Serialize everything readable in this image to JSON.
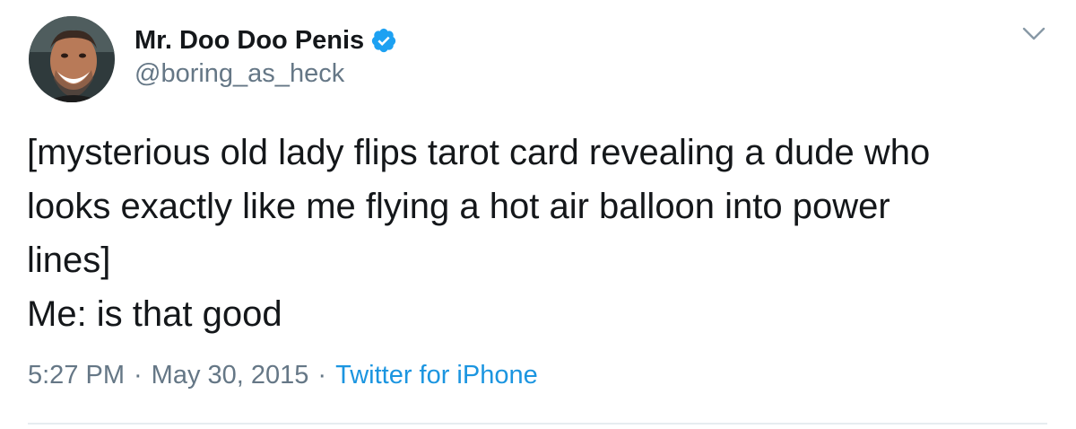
{
  "author": {
    "display_name": "Mr. Doo Doo Penis",
    "handle": "@boring_as_heck",
    "verified": true,
    "avatar_icon": "user-avatar"
  },
  "tweet": {
    "lines": [
      "[mysterious old lady flips tarot card revealing a dude who",
      "looks exactly like me flying a hot air balloon into power",
      "lines]",
      "Me: is that good"
    ]
  },
  "meta": {
    "time": "5:27 PM",
    "separator": "·",
    "date": "May 30, 2015",
    "source": "Twitter for iPhone"
  },
  "colors": {
    "text": "#14171a",
    "secondary": "#657786",
    "link": "#1b95e0",
    "verified": "#1da1f2",
    "divider": "#e6ecf0"
  },
  "icons": {
    "verified": "verified-badge-icon",
    "menu": "chevron-down-icon"
  }
}
